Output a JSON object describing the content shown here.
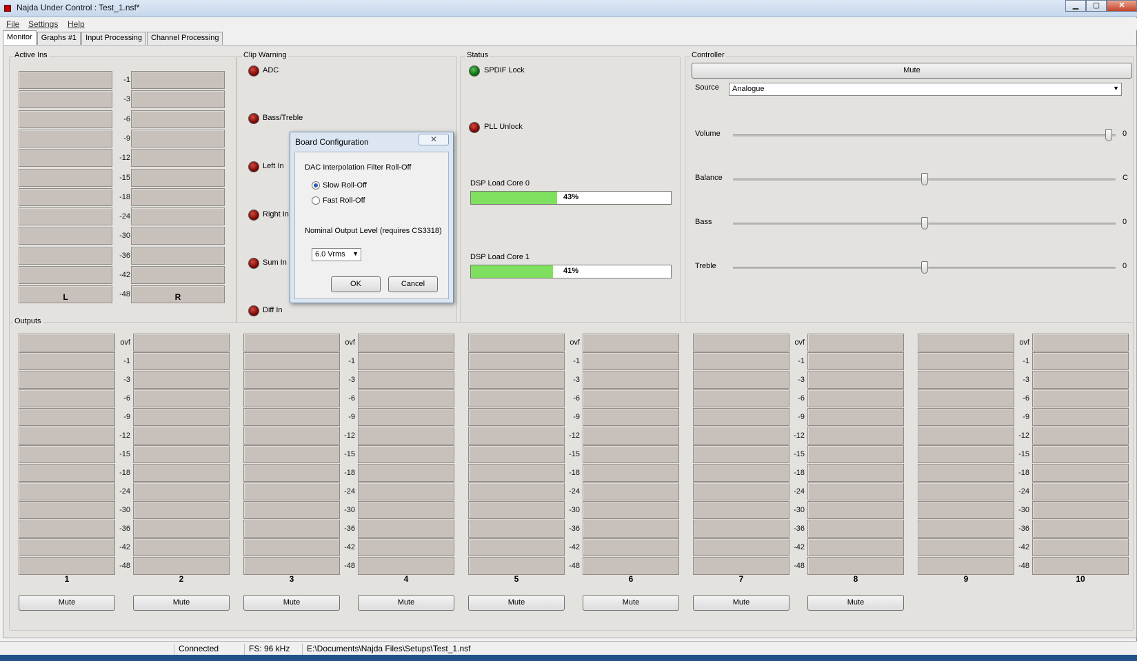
{
  "window": {
    "title": "Najda Under Control : Test_1.nsf*",
    "min": "▁",
    "max": "▢",
    "close": "✕"
  },
  "menu": [
    "File",
    "Settings",
    "Help"
  ],
  "tabs": [
    "Monitor",
    "Graphs #1",
    "Input Processing",
    "Channel Processing"
  ],
  "active_ins": {
    "title": "Active Ins",
    "ticks": [
      "-1",
      "-3",
      "-6",
      "-9",
      "-12",
      "-15",
      "-18",
      "-24",
      "-30",
      "-36",
      "-42",
      "-48"
    ],
    "channels": [
      "L",
      "R"
    ]
  },
  "clip_warning": {
    "title": "Clip Warning",
    "items": [
      "ADC",
      "Bass/Treble",
      "Left In",
      "Right In",
      "Sum In",
      "Diff In"
    ]
  },
  "status": {
    "title": "Status",
    "spdif": "SPDIF Lock",
    "pll": "PLL Unlock",
    "core0_label": "DSP Load Core 0",
    "core0_value": "43%",
    "core0_fraction": 0.43,
    "core1_label": "DSP Load Core 1",
    "core1_value": "41%",
    "core1_fraction": 0.41
  },
  "controller": {
    "title": "Controller",
    "mute": "Mute",
    "source_label": "Source",
    "source_value": "Analogue",
    "volume_label": "Volume",
    "volume_value": "0",
    "balance_label": "Balance",
    "balance_value": "C",
    "bass_label": "Bass",
    "bass_value": "0",
    "treble_label": "Treble",
    "treble_value": "0"
  },
  "outputs": {
    "title": "Outputs",
    "ticks": [
      "ovf",
      "-1",
      "-3",
      "-6",
      "-9",
      "-12",
      "-15",
      "-18",
      "-24",
      "-30",
      "-36",
      "-42",
      "-48"
    ],
    "channels": [
      "1",
      "2",
      "3",
      "4",
      "5",
      "6",
      "7",
      "8",
      "9",
      "10"
    ],
    "mute_label": "Mute"
  },
  "dialog": {
    "title": "Board Configuration",
    "close": "✕",
    "section1": "DAC Interpolation Filter Roll-Off",
    "radio1": "Slow Roll-Off",
    "radio2": "Fast Roll-Off",
    "section2": "Nominal Output Level (requires CS3318)",
    "level_value": "6.0 Vrms",
    "ok": "OK",
    "cancel": "Cancel"
  },
  "statusbar": {
    "connection": "Connected",
    "fs": "FS: 96 kHz",
    "path": "E:\\Documents\\Najda Files\\Setups\\Test_1.nsf"
  }
}
